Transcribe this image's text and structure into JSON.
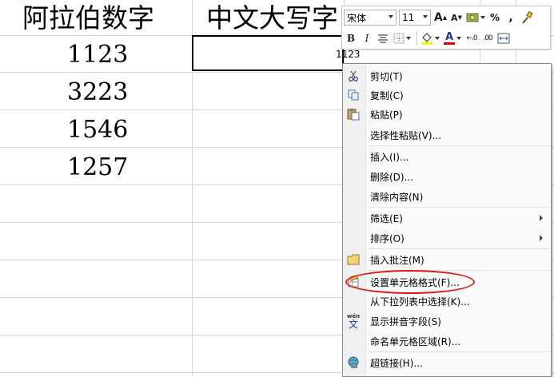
{
  "sheet": {
    "col_a_header": "阿拉伯数字",
    "col_b_header": "中文大写字",
    "rows": [
      "1123",
      "3223",
      "1546",
      "1257"
    ],
    "edit_value": "1123"
  },
  "mini_toolbar": {
    "font_name": "宋体",
    "font_size": "11",
    "grow_font": "A",
    "shrink_font": "A",
    "percent": "%",
    "comma": ",",
    "bold": "B",
    "italic": "I",
    "font_color_glyph": "A",
    "inc_decimal": "←.0",
    "dec_decimal": ".00",
    "font_color": "#e00000",
    "fill_color": "#ffff00"
  },
  "context_menu": {
    "items": [
      {
        "label": "剪切(T)",
        "icon": "scissors-icon"
      },
      {
        "label": "复制(C)",
        "icon": "copy-icon"
      },
      {
        "label": "粘贴(P)",
        "icon": "paste-icon"
      },
      {
        "label": "选择性粘贴(V)...",
        "icon": ""
      },
      {
        "label": "插入(I)...",
        "icon": ""
      },
      {
        "label": "删除(D)...",
        "icon": ""
      },
      {
        "label": "清除内容(N)",
        "icon": ""
      },
      {
        "label": "筛选(E)",
        "icon": "",
        "submenu": true
      },
      {
        "label": "排序(O)",
        "icon": "",
        "submenu": true
      },
      {
        "label": "插入批注(M)",
        "icon": "comment-icon"
      },
      {
        "label": "设置单元格格式(F)...",
        "icon": "format-cells-icon"
      },
      {
        "label": "从下拉列表中选择(K)...",
        "icon": ""
      },
      {
        "label": "显示拼音字段(S)",
        "icon": "phonetic-icon"
      },
      {
        "label": "命名单元格区域(R)...",
        "icon": ""
      },
      {
        "label": "超链接(H)...",
        "icon": "hyperlink-icon"
      }
    ],
    "phonetic_glyph_top": "wén",
    "phonetic_glyph_bottom": "文"
  }
}
